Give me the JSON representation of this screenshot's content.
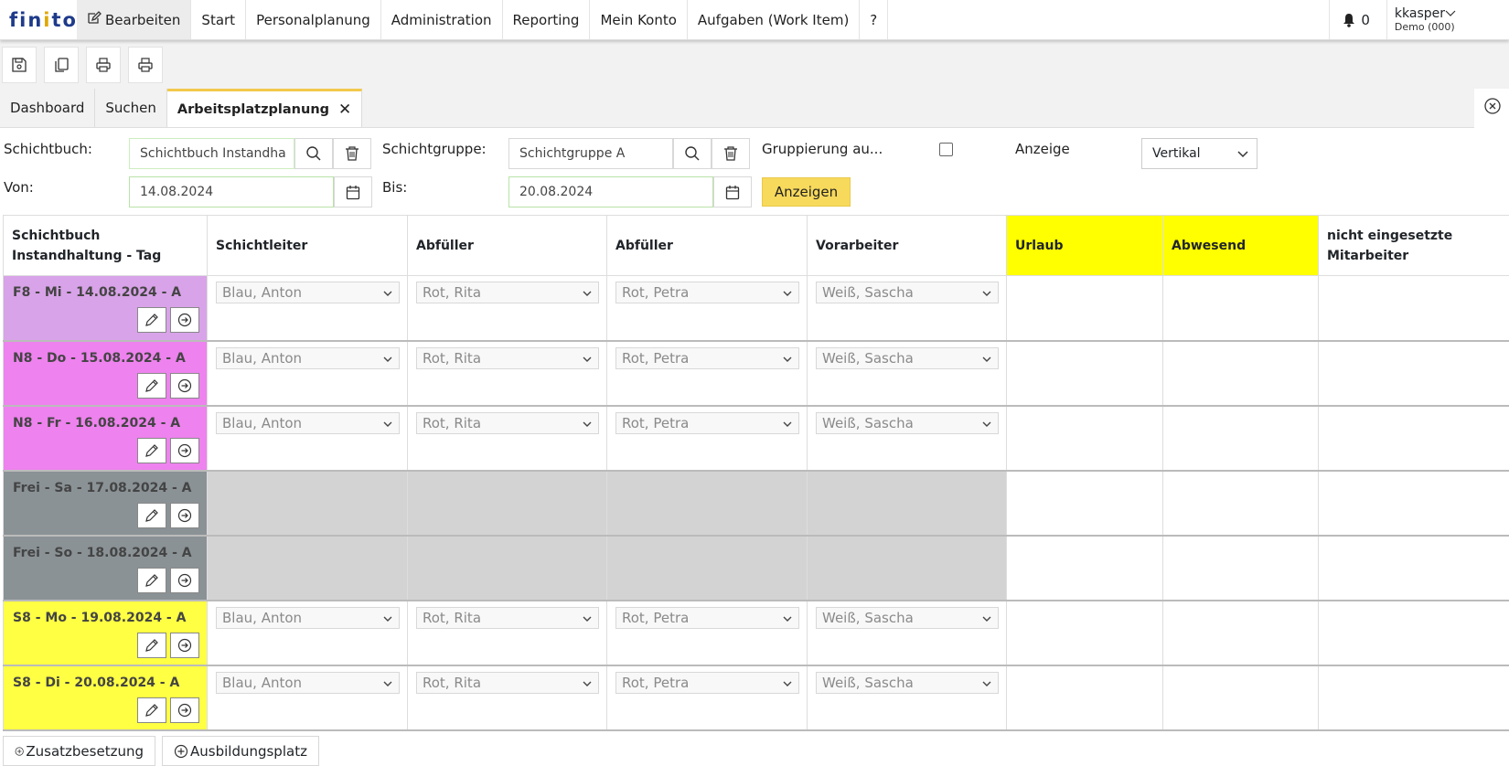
{
  "nav": {
    "logo": "finito",
    "items": [
      {
        "label": "Bearbeiten",
        "active": true
      },
      {
        "label": "Start"
      },
      {
        "label": "Personalplanung"
      },
      {
        "label": "Administration"
      },
      {
        "label": "Reporting"
      },
      {
        "label": "Mein Konto"
      },
      {
        "label": "Aufgaben (Work Item)"
      },
      {
        "label": "?"
      }
    ],
    "notifications": "0",
    "user": "kkasper",
    "org": "Demo (000)"
  },
  "tabs": [
    {
      "label": "Dashboard"
    },
    {
      "label": "Suchen"
    },
    {
      "label": "Arbeitsplatzplanung",
      "active": true
    }
  ],
  "form": {
    "schichtbuch_label": "Schichtbuch:",
    "schichtbuch_value": "Schichtbuch Instandha",
    "schichtgruppe_label": "Schichtgruppe:",
    "schichtgruppe_value": "Schichtgruppe A",
    "gruppierung_label": "Gruppierung au...",
    "anzeige_label": "Anzeige",
    "anzeige_value": "Vertikal",
    "von_label": "Von:",
    "von_value": "14.08.2024",
    "bis_label": "Bis:",
    "bis_value": "20.08.2024",
    "anzeigen_button": "Anzeigen"
  },
  "table": {
    "headers": [
      "Schichtbuch Instandhaltung - Tag",
      "Schichtleiter",
      "Abfüller",
      "Abfüller",
      "Vorarbeiter",
      "Urlaub",
      "Abwesend",
      "nicht eingesetzte Mitarbeiter"
    ],
    "rows": [
      {
        "label": "F8 - Mi - 14.08.2024 - A",
        "color": "#d8a3e8",
        "cells": [
          "Blau, Anton",
          "Rot, Rita",
          "Rot, Petra",
          "Weiß, Sascha"
        ]
      },
      {
        "label": "N8 - Do - 15.08.2024 - A",
        "color": "#ee82ee",
        "cells": [
          "Blau, Anton",
          "Rot, Rita",
          "Rot, Petra",
          "Weiß, Sascha"
        ]
      },
      {
        "label": "N8 - Fr - 16.08.2024 - A",
        "color": "#ee82ee",
        "cells": [
          "Blau, Anton",
          "Rot, Rita",
          "Rot, Petra",
          "Weiß, Sascha"
        ]
      },
      {
        "label": "Frei - Sa - 17.08.2024 - A",
        "color": "#8a9296",
        "cells": null
      },
      {
        "label": "Frei - So - 18.08.2024 - A",
        "color": "#8a9296",
        "cells": null
      },
      {
        "label": "S8 - Mo - 19.08.2024 - A",
        "color": "#ffff44",
        "cells": [
          "Blau, Anton",
          "Rot, Rita",
          "Rot, Petra",
          "Weiß, Sascha"
        ]
      },
      {
        "label": "S8 - Di - 20.08.2024 - A",
        "color": "#ffff44",
        "cells": [
          "Blau, Anton",
          "Rot, Rita",
          "Rot, Petra",
          "Weiß, Sascha"
        ]
      }
    ]
  },
  "footer": {
    "zusatz_button": "Zusatzbesetzung",
    "ausbildung_button": "Ausbildungsplatz"
  },
  "icons": {
    "save": "save-icon",
    "copy": "copy-icon",
    "print": "print-icon",
    "print_alt": "print-alt-icon",
    "search": "search-icon",
    "trash": "trash-icon",
    "calendar": "calendar-icon",
    "pencil": "pencil-icon",
    "arrow": "arrow-right-circle-icon",
    "bell": "bell-icon",
    "plus": "plus-circle-icon"
  }
}
